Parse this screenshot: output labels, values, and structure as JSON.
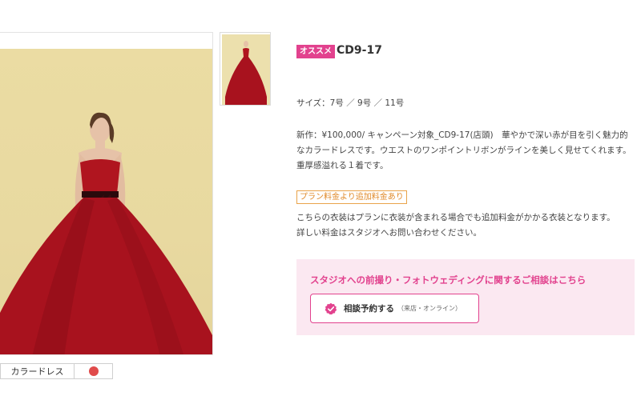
{
  "gallery": {
    "main_alt": "CD9-17",
    "heart_icon": "heart-icon"
  },
  "tags": {
    "category": "カラードレス",
    "color_swatch": "#e04b4b"
  },
  "product": {
    "badge": "オススメ",
    "code": "CD9-17",
    "sizes": "サイズ：7号 ／ 9号 ／ 11号",
    "description_line1": "新作：¥100,000/ キャンペーン対象_CD9-17(店頭)　華やかで深い赤が目を引く魅力的",
    "description_line2": "なカラードレスです。ウエストのワンポイントリボンがラインを美しく見せてくれます。",
    "description_line3": "重厚感溢れる１着です。",
    "fee_tag": "プラン料金より追加料金あり",
    "fee_note_line1": "こちらの衣装はプランに衣装が含まれる場合でも追加料金がかかる衣装となります。",
    "fee_note_line2": "詳しい料金はスタジオへお問い合わせください。"
  },
  "consult": {
    "title": "スタジオへの前撮り・フォトウェディングに関するご相談はこちら",
    "button_label": "相談予約する",
    "button_sub": "（来店・オンライン）"
  },
  "colors": {
    "accent_pink": "#e2428e",
    "consult_bg": "#fbe8f1",
    "fee_orange": "#e08a2a",
    "dress_red": "#a8121e"
  }
}
